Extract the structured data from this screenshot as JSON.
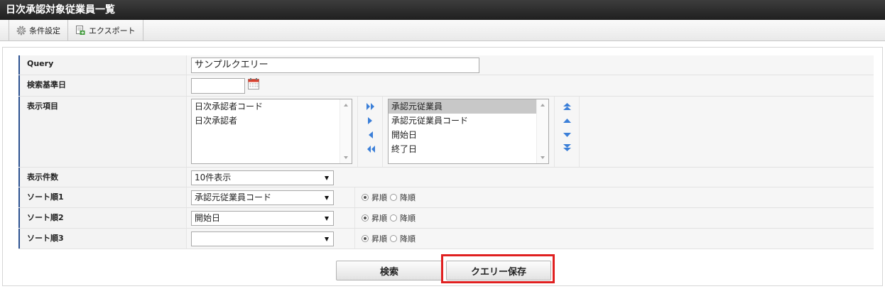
{
  "title": "日次承認対象従業員一覧",
  "toolbar": {
    "conditions_label": "条件設定",
    "export_label": "エクスポート"
  },
  "form": {
    "query": {
      "label": "Query",
      "value": "サンプルクエリー"
    },
    "base_date": {
      "label": "検索基準日",
      "value": ""
    },
    "display_items": {
      "label": "表示項目",
      "available": [
        "日次承認者コード",
        "日次承認者"
      ],
      "selected": [
        "承認元従業員",
        "承認元従業員コード",
        "開始日",
        "終了日"
      ],
      "selected_highlight": "承認元従業員"
    },
    "display_count": {
      "label": "表示件数",
      "value": "10件表示"
    },
    "sorts": [
      {
        "label": "ソート順1",
        "value": "承認元従業員コード",
        "asc": "昇順",
        "desc": "降順",
        "order": "asc"
      },
      {
        "label": "ソート順2",
        "value": "開始日",
        "asc": "昇順",
        "desc": "降順",
        "order": "asc"
      },
      {
        "label": "ソート順3",
        "value": "",
        "asc": "昇順",
        "desc": "降順",
        "order": "asc"
      }
    ]
  },
  "buttons": {
    "search_label": "検索",
    "save_query_label": "クエリー保存"
  },
  "colors": {
    "label_accent": "#2c5191",
    "arrow_blue": "#3b7fd8",
    "highlight": "#e02020"
  }
}
